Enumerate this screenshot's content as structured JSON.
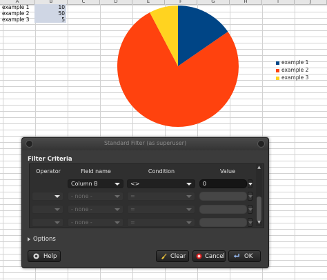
{
  "sheet": {
    "columns": [
      "A",
      "B",
      "C",
      "D",
      "E",
      "F",
      "G",
      "H",
      "I",
      "J"
    ],
    "rows": [
      {
        "label": "example 1",
        "value": "10"
      },
      {
        "label": "example 2",
        "value": "50"
      },
      {
        "label": "example 3",
        "value": "5"
      }
    ]
  },
  "chart_data": {
    "type": "pie",
    "categories": [
      "example 1",
      "example 2",
      "example 3"
    ],
    "values": [
      10,
      50,
      5
    ],
    "colors": [
      "#004586",
      "#ff420e",
      "#ffd320"
    ],
    "legend_position": "right"
  },
  "dialog": {
    "title": "Standard Filter (as superuser)",
    "section": "Filter Criteria",
    "headers": {
      "operator": "Operator",
      "field": "Field name",
      "condition": "Condition",
      "value": "Value"
    },
    "rows": [
      {
        "operator": "",
        "field": "Column B",
        "condition": "<>",
        "value": "0",
        "enabled": true
      },
      {
        "operator": "",
        "field": "- none -",
        "condition": "=",
        "value": "",
        "enabled": false
      },
      {
        "operator": "",
        "field": "- none -",
        "condition": "=",
        "value": "",
        "enabled": false
      },
      {
        "operator": "",
        "field": "- none -",
        "condition": "=",
        "value": "",
        "enabled": false
      }
    ],
    "options_label": "Options",
    "buttons": {
      "help": "Help",
      "clear": "Clear",
      "cancel": "Cancel",
      "ok": "OK"
    }
  }
}
